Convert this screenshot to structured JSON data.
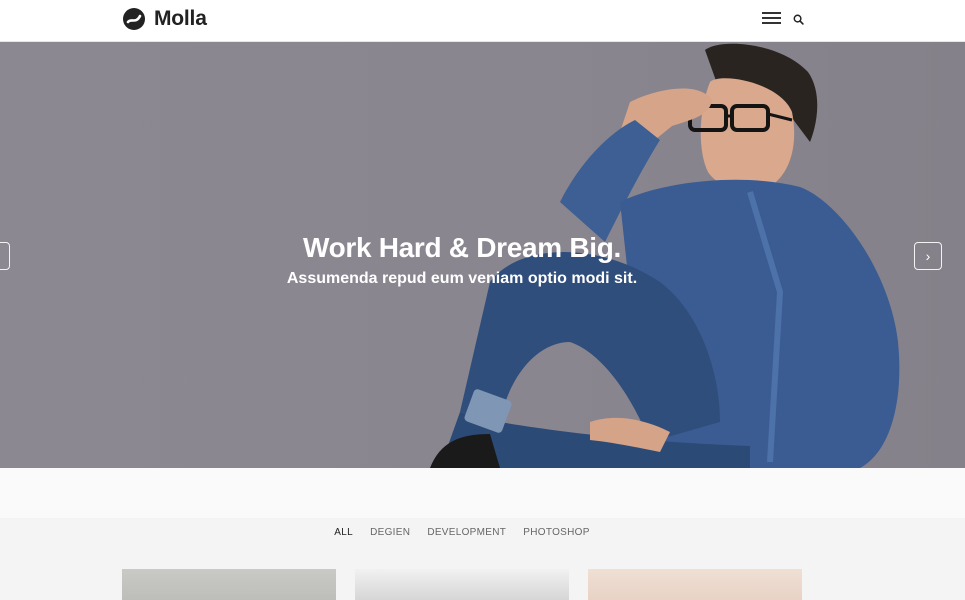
{
  "brand": {
    "name": "Molla"
  },
  "header": {
    "menu_icon": "hamburger-icon",
    "search_icon": "search-icon"
  },
  "hero": {
    "title": "Work Hard & Dream Big.",
    "subtitle": "Assumenda repud eum veniam optio modi sit.",
    "prev_icon": "chevron-left-icon",
    "next_icon": "chevron-right-icon",
    "prev_glyph": "‹",
    "next_glyph": "›"
  },
  "filters": {
    "items": [
      "ALL",
      "DEGIEN",
      "DEVELOPMENT",
      "PHOTOSHOP"
    ],
    "active": "ALL"
  },
  "colors": {
    "accent": "#333333",
    "header_bg": "#ffffff",
    "hero_bg": "#8a8690"
  }
}
